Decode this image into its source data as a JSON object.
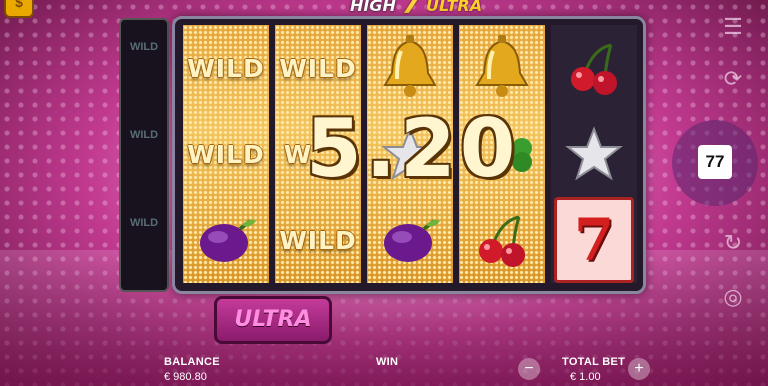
{
  "game": {
    "logo_high": "HIGH",
    "logo_seven": "7",
    "logo_ultra": "ULTRA",
    "coin_icon_glyph": "$"
  },
  "side_reel": {
    "cells": [
      "WILD",
      "",
      "WILD",
      "",
      "WILD",
      ""
    ]
  },
  "reels": [
    [
      "WILD",
      "WILD",
      "plum"
    ],
    [
      "WILD",
      "W",
      "WILD"
    ],
    [
      "bell",
      "star",
      "plum"
    ],
    [
      "bell",
      "clover",
      "cherry"
    ],
    [
      "cherry",
      "star",
      "seven"
    ]
  ],
  "win_display": "5.20",
  "ultra_button": "ULTRA",
  "free_spins": "77",
  "footer": {
    "balance_label": "BALANCE",
    "balance_value": "€ 980.80",
    "win_label": "WIN",
    "total_bet_label": "TOTAL BET",
    "total_bet_value": "€ 1.00",
    "minus": "−",
    "plus": "+"
  },
  "colors": {
    "accent": "#ffcf2a",
    "background": "#e87ac4",
    "ultra": "#ff8ee0"
  }
}
